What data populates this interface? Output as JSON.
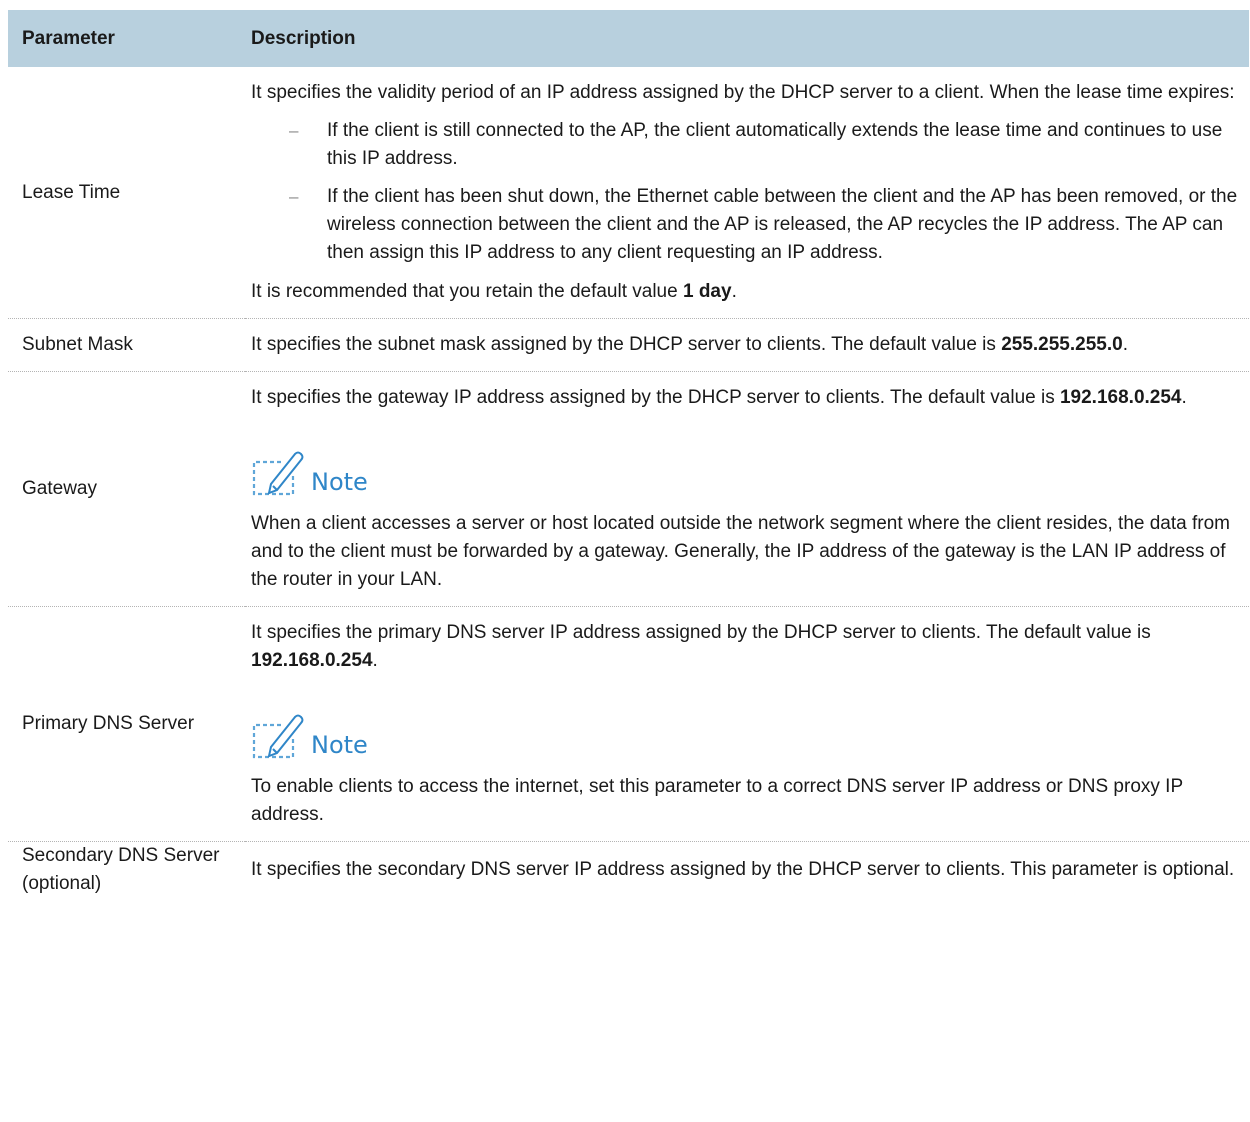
{
  "table": {
    "headers": {
      "parameter": "Parameter",
      "description": "Description"
    },
    "rows": {
      "lease_time": {
        "name": "Lease Time",
        "intro": "It specifies the validity period of an IP address assigned by the DHCP server to a client. When the lease time expires:",
        "bullets": [
          "If the client is still connected to the AP, the client automatically extends the lease time and continues to use this IP address.",
          "If the client has been shut down, the Ethernet cable between the client and the AP has been removed, or the wireless connection between the client and the AP is released, the AP recycles the IP address. The AP can then assign this IP address to any client requesting an IP address."
        ],
        "bullet_marker": "–",
        "recommend_prefix": "It is recommended that you retain the default value ",
        "recommend_value": "1 day",
        "recommend_suffix": "."
      },
      "subnet_mask": {
        "name": "Subnet Mask",
        "text_prefix": "It specifies the subnet mask assigned by the DHCP server to clients. The default value is ",
        "text_value": "255.255.255.0",
        "text_suffix": "."
      },
      "gateway": {
        "name": "Gateway",
        "text_prefix": "It specifies the gateway IP address assigned by the DHCP server to clients. The default value is ",
        "text_value": "192.168.0.254",
        "text_suffix": ".",
        "note_label": "Note",
        "note_text": "When a client accesses a server or host located outside the network segment where the client resides, the data from and to the client must be forwarded by a gateway. Generally, the IP address of the gateway is the LAN IP address of the router in your LAN."
      },
      "primary_dns": {
        "name": "Primary DNS Server",
        "text_prefix": "It specifies the primary DNS server IP address assigned by the DHCP server to clients. The default value is ",
        "text_value": "192.168.0.254",
        "text_suffix": ".",
        "note_label": "Note",
        "note_text": "To enable clients to access the internet, set this parameter to a correct DNS server IP address or DNS proxy IP address."
      },
      "secondary_dns": {
        "name": "Secondary DNS Server (optional)",
        "text": "It specifies the secondary DNS server IP address assigned by the DHCP server to clients. This parameter is optional."
      }
    }
  },
  "colors": {
    "header_bg": "#b8d0de",
    "note_accent": "#2f86c8",
    "text": "#1a1a1a"
  },
  "icons": {
    "note": "note-pencil-icon"
  }
}
